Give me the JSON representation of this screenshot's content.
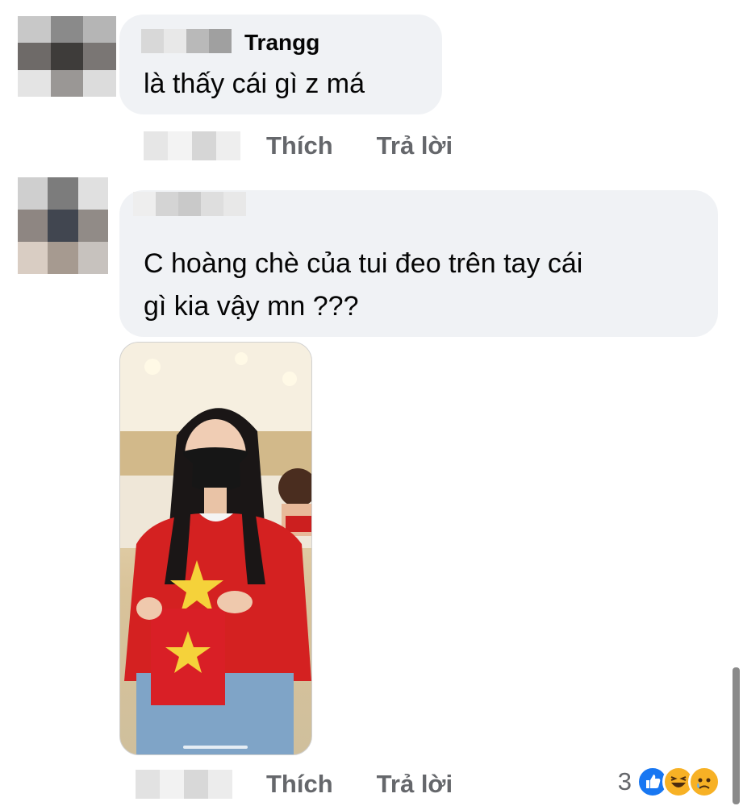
{
  "comments": [
    {
      "author": "Trangg",
      "text": "là thấy cái gì z má",
      "actions": {
        "like": "Thích",
        "reply": "Trả lời"
      }
    },
    {
      "author": "",
      "text_line1": "C hoàng chè của tui đeo trên tay cái",
      "text_line2": "gì kia vậy mn ???",
      "actions": {
        "like": "Thích",
        "reply": "Trả lời"
      },
      "reactions": {
        "count": "3",
        "icons": [
          "like-icon",
          "haha-icon",
          "sad-icon"
        ],
        "colors": {
          "like": "#1877f2",
          "haha": "#f7b125",
          "sad": "#f7b125"
        }
      }
    }
  ],
  "colors": {
    "bubble": "#f0f2f5",
    "action_text": "#65676b",
    "text": "#050505"
  }
}
